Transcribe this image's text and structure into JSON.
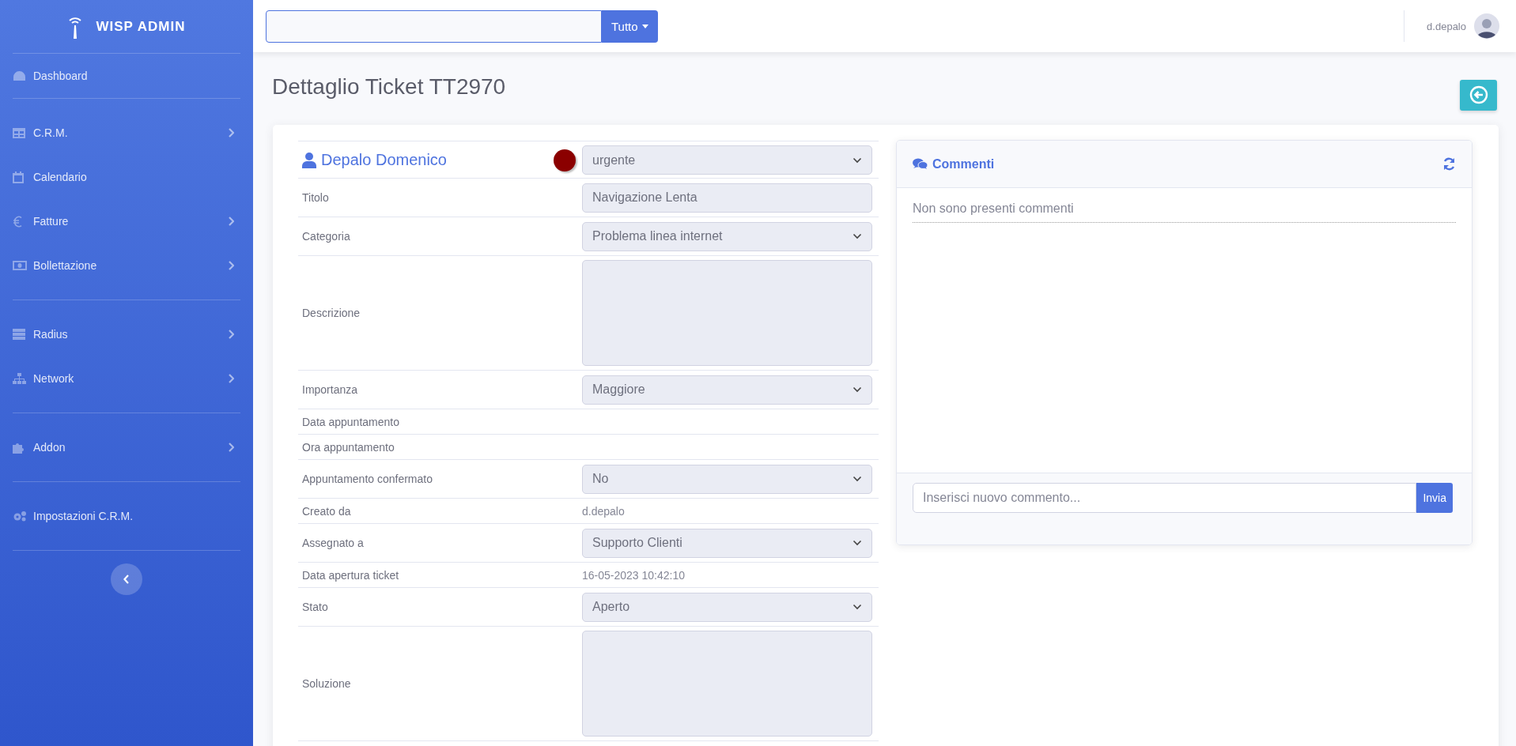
{
  "sidebar": {
    "brand": "WISP ADMIN",
    "groups": [
      [
        {
          "label": "Dashboard",
          "has_submenu": false
        }
      ],
      [
        {
          "label": "C.R.M.",
          "has_submenu": true
        },
        {
          "label": "Calendario",
          "has_submenu": false
        },
        {
          "label": "Fatture",
          "has_submenu": true
        },
        {
          "label": "Bollettazione",
          "has_submenu": true
        }
      ],
      [
        {
          "label": "Radius",
          "has_submenu": true
        },
        {
          "label": "Network",
          "has_submenu": true
        }
      ],
      [
        {
          "label": "Addon",
          "has_submenu": true
        }
      ],
      [
        {
          "label": "Impostazioni C.R.M.",
          "has_submenu": false
        }
      ]
    ]
  },
  "topbar": {
    "search": {
      "filter": "Tutto"
    },
    "user": "d.depalo"
  },
  "page": {
    "title": "Dettaglio Ticket TT2970"
  },
  "ticket": {
    "customer": "Depalo Domenico",
    "priority": {
      "value": "urgente",
      "color": "#8b0000"
    },
    "rows": [
      {
        "kind": "input",
        "label": "Titolo",
        "value": "Navigazione Lenta"
      },
      {
        "kind": "select",
        "label": "Categoria",
        "value": "Problema linea internet"
      },
      {
        "kind": "textarea",
        "label": "Descrizione"
      },
      {
        "kind": "select",
        "label": "Importanza",
        "value": "Maggiore"
      },
      {
        "kind": "text",
        "label": "Data appuntamento"
      },
      {
        "kind": "text",
        "label": "Ora appuntamento"
      },
      {
        "kind": "select",
        "label": "Appuntamento confermato",
        "value": "No"
      },
      {
        "kind": "text",
        "label": "Creato da",
        "value": "d.depalo"
      },
      {
        "kind": "select",
        "label": "Assegnato a",
        "value": "Supporto Clienti"
      },
      {
        "kind": "text",
        "label": "Data apertura ticket",
        "value": "16-05-2023 10:42:10"
      },
      {
        "kind": "select",
        "label": "Stato",
        "value": "Aperto"
      },
      {
        "kind": "textarea",
        "label": "Soluzione"
      }
    ]
  },
  "comments": {
    "title": "Commenti",
    "empty_message": "Non sono presenti commenti",
    "placeholder": "Inserisci nuovo commento...",
    "send": "Invia"
  }
}
